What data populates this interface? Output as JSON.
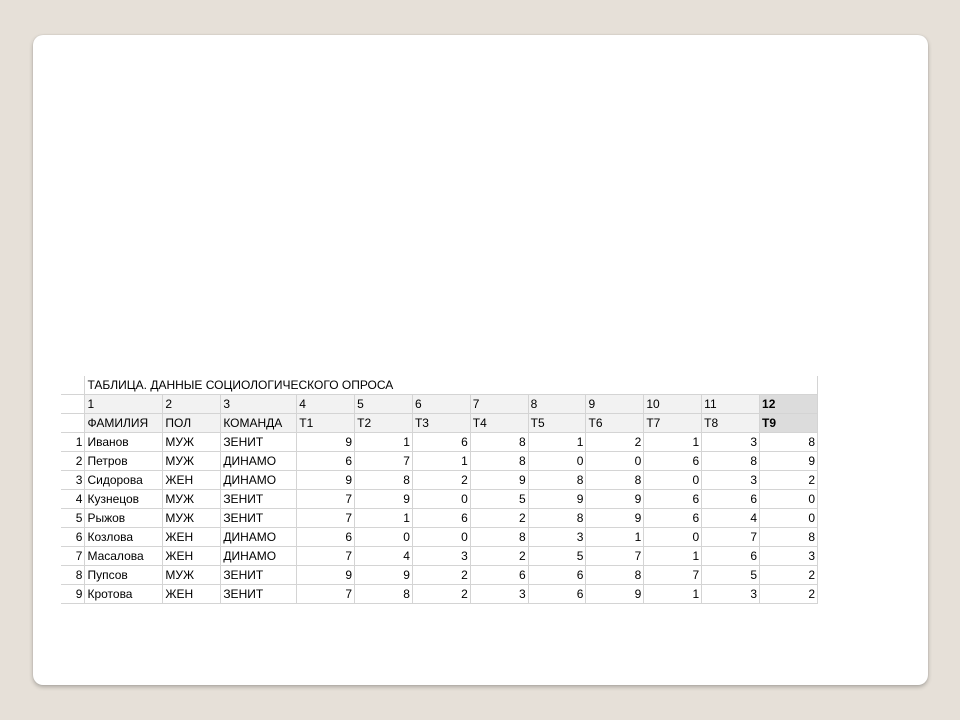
{
  "table": {
    "title": "ТАБЛИЦА. ДАННЫЕ СОЦИОЛОГИЧЕСКОГО ОПРОСА",
    "col_numbers": [
      "1",
      "2",
      "3",
      "4",
      "5",
      "6",
      "7",
      "8",
      "9",
      "10",
      "11",
      "12"
    ],
    "col_names": [
      "ФАМИЛИЯ",
      "ПОЛ",
      "КОМАНДА",
      "T1",
      "T2",
      "T3",
      "T4",
      "T5",
      "T6",
      "T7",
      "T8",
      "T9"
    ],
    "rows": [
      {
        "n": "1",
        "cells": [
          "Иванов",
          "МУЖ",
          "ЗЕНИТ",
          "9",
          "1",
          "6",
          "8",
          "1",
          "2",
          "1",
          "3",
          "8"
        ]
      },
      {
        "n": "2",
        "cells": [
          "Петров",
          "МУЖ",
          "ДИНАМО",
          "6",
          "7",
          "1",
          "8",
          "0",
          "0",
          "6",
          "8",
          "9"
        ]
      },
      {
        "n": "3",
        "cells": [
          "Сидорова",
          "ЖЕН",
          "ДИНАМО",
          "9",
          "8",
          "2",
          "9",
          "8",
          "8",
          "0",
          "3",
          "2"
        ]
      },
      {
        "n": "4",
        "cells": [
          "Кузнецов",
          "МУЖ",
          "ЗЕНИТ",
          "7",
          "9",
          "0",
          "5",
          "9",
          "9",
          "6",
          "6",
          "0"
        ]
      },
      {
        "n": "5",
        "cells": [
          "Рыжов",
          "МУЖ",
          "ЗЕНИТ",
          "7",
          "1",
          "6",
          "2",
          "8",
          "9",
          "6",
          "4",
          "0"
        ]
      },
      {
        "n": "6",
        "cells": [
          "Козлова",
          "ЖЕН",
          "ДИНАМО",
          "6",
          "0",
          "0",
          "8",
          "3",
          "1",
          "0",
          "7",
          "8"
        ]
      },
      {
        "n": "7",
        "cells": [
          "Масалова",
          "ЖЕН",
          "ДИНАМО",
          "7",
          "4",
          "3",
          "2",
          "5",
          "7",
          "1",
          "6",
          "3"
        ]
      },
      {
        "n": "8",
        "cells": [
          "Пупсов",
          "МУЖ",
          "ЗЕНИТ",
          "9",
          "9",
          "2",
          "6",
          "6",
          "8",
          "7",
          "5",
          "2"
        ]
      },
      {
        "n": "9",
        "cells": [
          "Кротова",
          "ЖЕН",
          "ЗЕНИТ",
          "7",
          "8",
          "2",
          "3",
          "6",
          "9",
          "1",
          "3",
          "2"
        ]
      }
    ]
  },
  "colors": {
    "page_background": "#e6e0d8",
    "slide_background": "#ffffff",
    "header_fill": "#f2f2f2",
    "selected_header_fill": "#dcdcdc",
    "gridline": "#d4d4d4"
  }
}
